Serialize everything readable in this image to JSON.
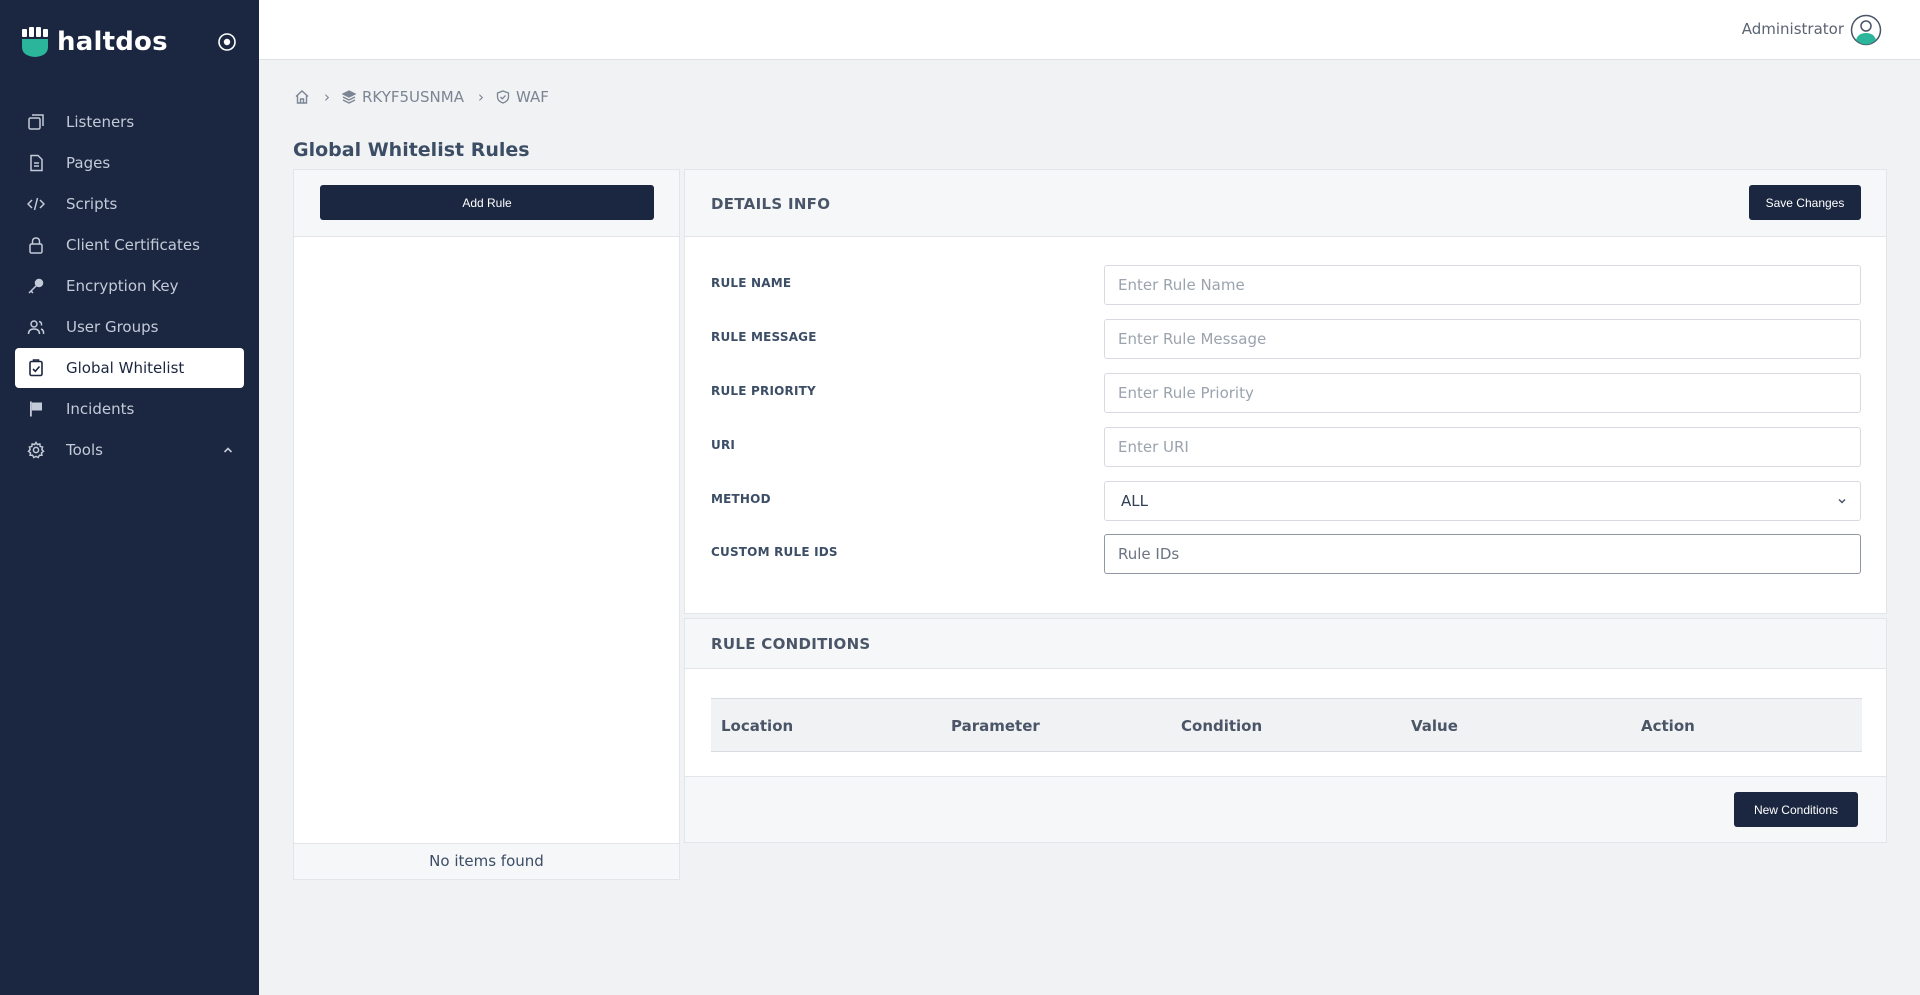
{
  "brand": {
    "name": "haltdos"
  },
  "sidebar": {
    "items": [
      {
        "label": "Listeners",
        "icon": "listeners-icon"
      },
      {
        "label": "Pages",
        "icon": "pages-icon"
      },
      {
        "label": "Scripts",
        "icon": "code-icon"
      },
      {
        "label": "Client Certificates",
        "icon": "lock-icon"
      },
      {
        "label": "Encryption Key",
        "icon": "key-icon"
      },
      {
        "label": "User Groups",
        "icon": "users-icon"
      },
      {
        "label": "Global Whitelist",
        "icon": "clipboard-check-icon",
        "active": true
      },
      {
        "label": "Incidents",
        "icon": "flag-icon"
      },
      {
        "label": "Tools",
        "icon": "gear-icon",
        "expandable": true
      }
    ]
  },
  "header": {
    "user": "Administrator"
  },
  "breadcrumb": {
    "items": [
      "RKYF5USNMA",
      "WAF"
    ]
  },
  "page": {
    "title": "Global Whitelist Rules"
  },
  "rules_list": {
    "add_label": "Add Rule",
    "empty_text": "No items found"
  },
  "details": {
    "title": "DETAILS INFO",
    "save_label": "Save Changes",
    "fields": [
      {
        "label": "RULE NAME",
        "placeholder": "Enter Rule Name"
      },
      {
        "label": "RULE MESSAGE",
        "placeholder": "Enter Rule Message"
      },
      {
        "label": "RULE PRIORITY",
        "placeholder": "Enter Rule Priority"
      },
      {
        "label": "URI",
        "placeholder": "Enter URI"
      },
      {
        "label": "METHOD",
        "value": "ALL"
      },
      {
        "label": "CUSTOM RULE IDS",
        "placeholder": "Rule IDs"
      }
    ]
  },
  "conditions": {
    "title": "RULE CONDITIONS",
    "columns": [
      "Location",
      "Parameter",
      "Condition",
      "Value",
      "Action"
    ],
    "new_label": "New Conditions"
  },
  "colors": {
    "sidebar_bg": "#1b2640",
    "accent": "#1b2640",
    "brand_accent": "#2bb59a"
  }
}
